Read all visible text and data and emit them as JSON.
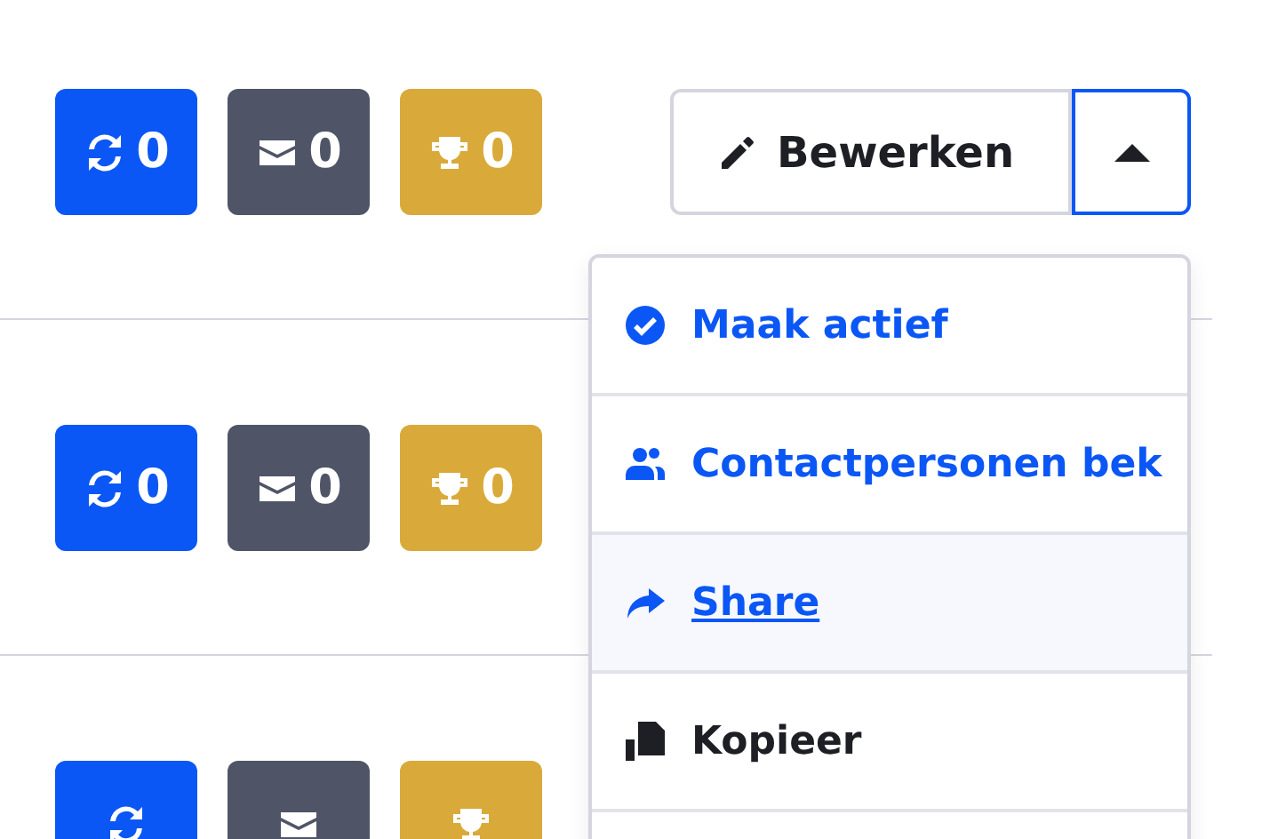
{
  "rows": [
    {
      "badges": [
        {
          "kind": "sync",
          "color": "#0b57f5",
          "count": "0"
        },
        {
          "kind": "mail",
          "color": "#4f5567",
          "count": "0"
        },
        {
          "kind": "trophy",
          "color": "#d9aa3a",
          "count": "0"
        }
      ],
      "edit_button": {
        "label": "Bewerken",
        "expanded": true
      }
    },
    {
      "badges": [
        {
          "kind": "sync",
          "color": "#0b57f5",
          "count": "0"
        },
        {
          "kind": "mail",
          "color": "#4f5567",
          "count": "0"
        },
        {
          "kind": "trophy",
          "color": "#d9aa3a",
          "count": "0"
        }
      ]
    },
    {
      "badges": [
        {
          "kind": "sync",
          "color": "#0b57f5"
        },
        {
          "kind": "mail",
          "color": "#4f5567"
        },
        {
          "kind": "trophy",
          "color": "#d9aa3a"
        }
      ]
    }
  ],
  "menu": {
    "items": [
      {
        "kind": "check",
        "label": "Maak actief",
        "primary": true,
        "highlighted": false
      },
      {
        "kind": "users",
        "label": "Contactpersonen bek",
        "primary": true,
        "highlighted": false
      },
      {
        "kind": "share",
        "label": "Share",
        "primary": true,
        "highlighted": true
      },
      {
        "kind": "copy",
        "label": "Kopieer",
        "primary": false,
        "highlighted": false
      }
    ]
  }
}
